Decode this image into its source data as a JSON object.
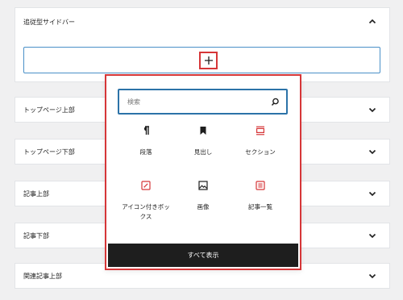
{
  "panels": [
    {
      "title": "追従型サイドバー",
      "expanded": true
    },
    {
      "title": "トップページ上部",
      "expanded": false
    },
    {
      "title": "トップページ下部",
      "expanded": false
    },
    {
      "title": "記事上部",
      "expanded": false
    },
    {
      "title": "記事下部",
      "expanded": false
    },
    {
      "title": "関連記事上部",
      "expanded": false
    }
  ],
  "inserter": {
    "search_placeholder": "検索",
    "blocks": [
      {
        "label": "段落",
        "icon": "paragraph-icon"
      },
      {
        "label": "見出し",
        "icon": "heading-bookmark-icon"
      },
      {
        "label": "セクション",
        "icon": "section-icon"
      },
      {
        "label": "アイコン付きボックス",
        "icon": "icon-box-icon"
      },
      {
        "label": "画像",
        "icon": "image-icon"
      },
      {
        "label": "記事一覧",
        "icon": "post-list-icon"
      }
    ],
    "show_all_label": "すべて表示"
  },
  "colors": {
    "accent_red": "#d63638",
    "focus_blue": "#2c73a8",
    "button_dark": "#1e1e1e"
  }
}
